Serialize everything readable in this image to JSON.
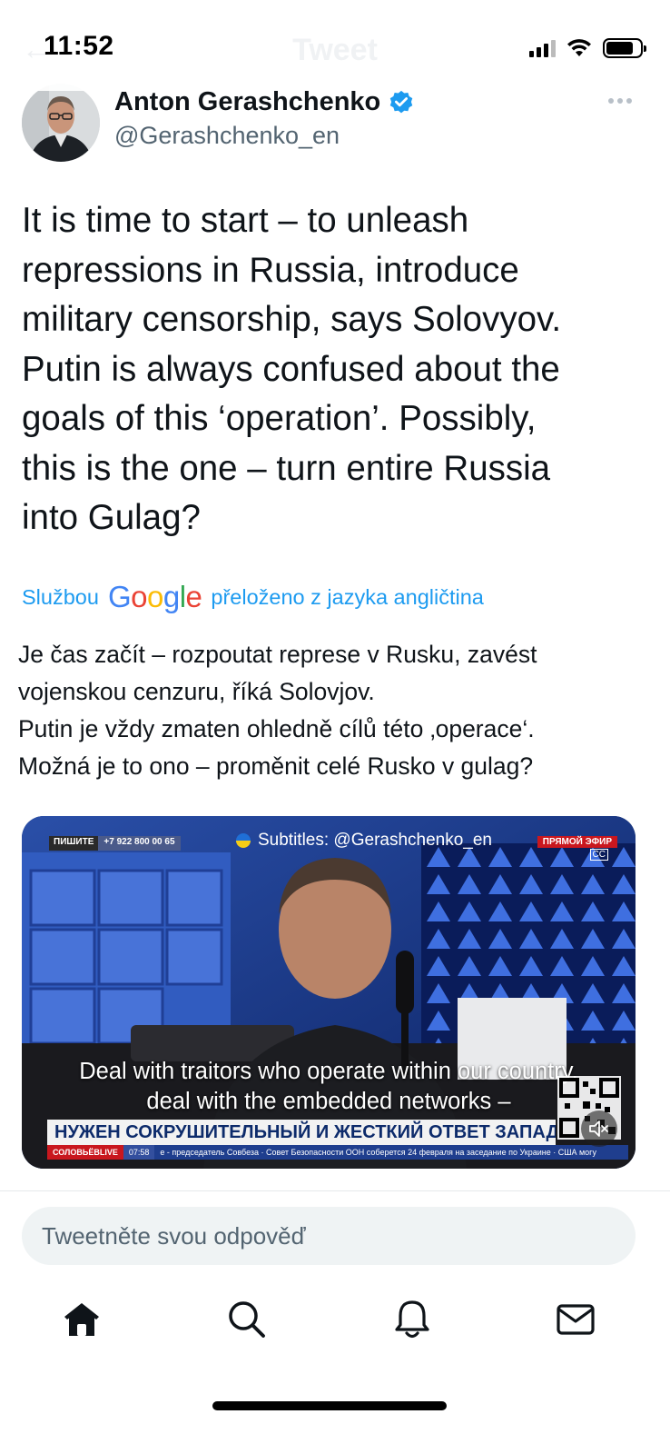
{
  "status_bar": {
    "time": "11:52"
  },
  "header": {
    "ghost_title": "Tweet",
    "back_glyph": "←"
  },
  "author": {
    "name": "Anton Gerashchenko",
    "handle": "@Gerashchenko_en",
    "verified": true
  },
  "tweet": {
    "text": "It is time to start – to unleash\nrepressions in Russia, introduce\nmilitary censorship, says Solovyov.\nPutin is always confused about the\ngoals of this ‘operation’. Possibly,\nthis is the one – turn entire Russia\ninto Gulag?"
  },
  "translation": {
    "prefix": "Službou",
    "google": [
      "G",
      "o",
      "o",
      "g",
      "l",
      "e"
    ],
    "suffix": "přeloženo z jazyka angličtina",
    "text": "Je čas začít – rozpoutat represe v Rusku, zavést\nvojenskou cenzuru, říká Solovjov.\nPutin je vždy zmaten ohledně cílů této ‚operace‘.\nMožná je to ono – proměnit celé Rusko v gulag?"
  },
  "media": {
    "channel_label": "ПИШИТЕ",
    "channel_phone": "+7 922 800 00 65",
    "subtitles_credit": "Subtitles: @Gerashchenko_en",
    "live_label": "ПРЯМОЙ ЭФИР",
    "cc_label": "CC",
    "caption_line1": "Deal with traitors who operate within our country,",
    "caption_line2": "deal with the embedded networks –",
    "chyron": "НУЖЕН СОКРУШИТЕЛЬНЫЙ И ЖЕСТКИЙ ОТВЕТ ЗАПАДУ",
    "ticker_brand": "СОЛОВЬЁВLIVE",
    "ticker_time": "07:58",
    "ticker_text": "е - председатель Совбеза · Совет Безопасности ООН соберется 24 февраля на заседание по Украине · США могу"
  },
  "reply": {
    "placeholder": "Tweetněte svou odpověď"
  },
  "tabs": [
    "home-icon",
    "search-icon",
    "notifications-icon",
    "messages-icon"
  ],
  "colors": {
    "link": "#1d9bf0",
    "text": "#0f1419",
    "secondary": "#536471",
    "reply_bg": "#eff3f4"
  }
}
